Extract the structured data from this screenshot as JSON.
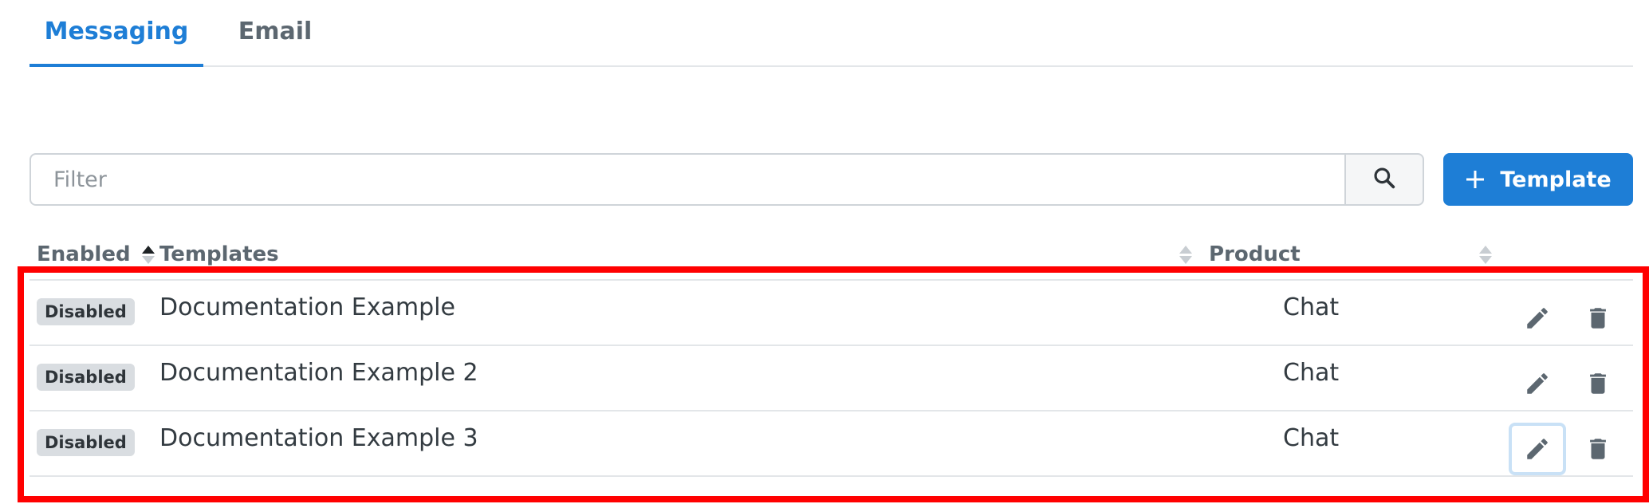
{
  "tabs": [
    {
      "label": "Messaging",
      "active": true
    },
    {
      "label": "Email",
      "active": false
    }
  ],
  "filter": {
    "placeholder": "Filter",
    "value": ""
  },
  "add_button": {
    "label": "Template",
    "icon": "plus-icon"
  },
  "search_button": {
    "icon": "search-icon"
  },
  "columns": {
    "enabled": "Enabled",
    "templates": "Templates",
    "product": "Product"
  },
  "sort": {
    "column": "Enabled",
    "direction": "ascending"
  },
  "rows": [
    {
      "status": "Disabled",
      "name": "Documentation Example",
      "product": "Chat"
    },
    {
      "status": "Disabled",
      "name": "Documentation Example 2",
      "product": "Chat"
    },
    {
      "status": "Disabled",
      "name": "Documentation Example 3",
      "product": "Chat"
    }
  ],
  "row_actions": {
    "edit_icon": "pencil-icon",
    "delete_icon": "trash-icon"
  },
  "colors": {
    "accent": "#1e7ed6",
    "badge_bg": "#d9dde1",
    "highlight": "#ff0000",
    "icon": "#5c6770"
  }
}
